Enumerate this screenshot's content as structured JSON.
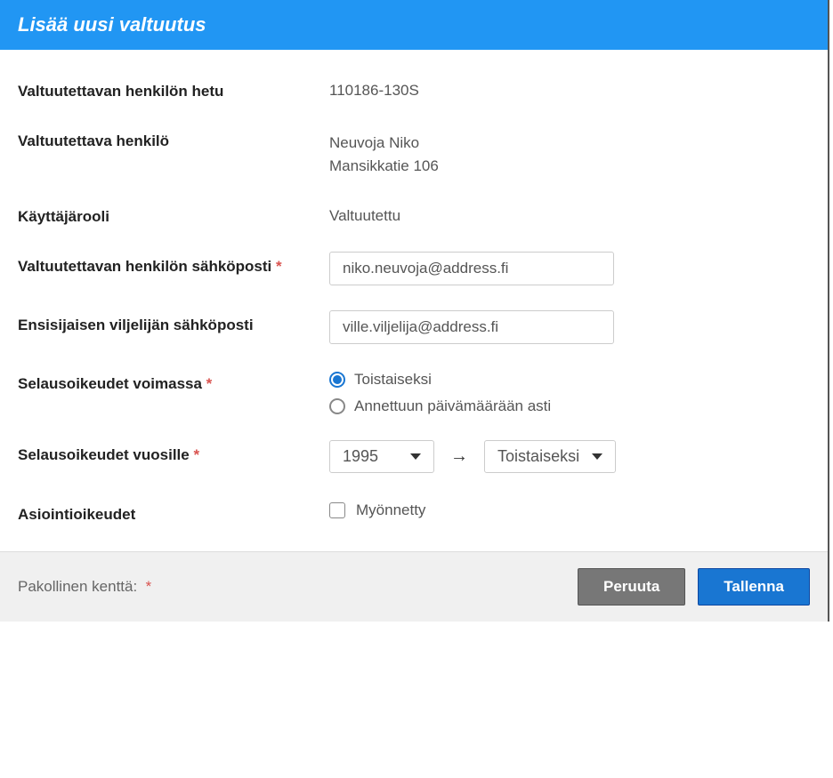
{
  "header": {
    "title": "Lisää uusi valtuutus"
  },
  "fields": {
    "hetu": {
      "label": "Valtuutettavan henkilön hetu",
      "value": "110186-130S"
    },
    "person": {
      "label": "Valtuutettava henkilö",
      "name": "Neuvoja Niko",
      "address": "Mansikkatie 106"
    },
    "role": {
      "label": "Käyttäjärooli",
      "value": "Valtuutettu"
    },
    "email1": {
      "label": "Valtuutettavan henkilön sähköposti",
      "value": "niko.neuvoja@address.fi",
      "required": "*"
    },
    "email2": {
      "label": "Ensisijaisen viljelijän sähköposti",
      "value": "ville.viljelija@address.fi"
    },
    "validity": {
      "label": "Selausoikeudet voimassa",
      "required": "*",
      "option1": "Toistaiseksi",
      "option2": "Annettuun päivämäärään asti"
    },
    "years": {
      "label": "Selausoikeudet vuosille",
      "required": "*",
      "from": "1995",
      "arrow": "→",
      "to": "Toistaiseksi"
    },
    "rights": {
      "label": "Asiointioikeudet",
      "option": "Myönnetty"
    }
  },
  "footer": {
    "required_label": "Pakollinen kenttä:",
    "required_mark": "*",
    "cancel": "Peruuta",
    "save": "Tallenna"
  }
}
